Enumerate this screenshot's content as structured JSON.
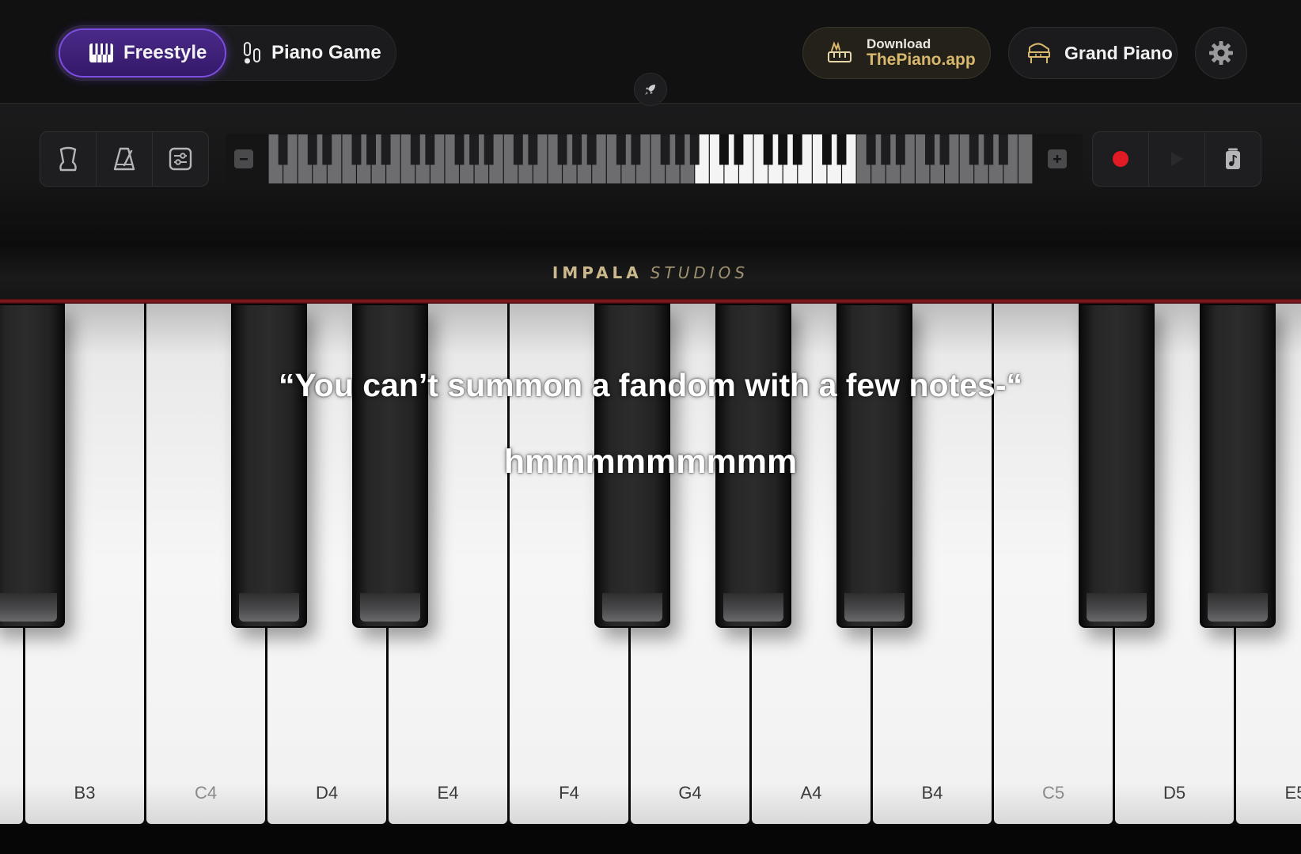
{
  "header": {
    "modes": [
      {
        "label": "Freestyle",
        "icon": "piano-keys-icon",
        "active": true
      },
      {
        "label": "Piano Game",
        "icon": "piano-game-icon",
        "active": false
      }
    ],
    "download": {
      "line1": "Download",
      "line2": "ThePiano.app",
      "icon": "piano-hand-icon"
    },
    "instrument": {
      "label": "Grand Piano",
      "icon": "grand-piano-icon"
    },
    "settings_icon": "gear-icon",
    "rocket_icon": "rocket-icon"
  },
  "controls": {
    "left_tools": [
      "sustain-pedal-icon",
      "metronome-icon",
      "equalizer-icon"
    ],
    "zoom_out_icon": "minus-icon",
    "zoom_in_icon": "plus-icon",
    "right_tools": [
      "record-icon",
      "play-icon",
      "song-file-icon"
    ],
    "minimap": {
      "total_white_keys": 52,
      "visible_start": 29,
      "visible_end": 39
    }
  },
  "brand": {
    "part1": "IMPALA",
    "part2": "STUDIOS"
  },
  "keyboard": {
    "white_keys": [
      {
        "note": "",
        "muted": false
      },
      {
        "note": "B3",
        "muted": false
      },
      {
        "note": "C4",
        "muted": true
      },
      {
        "note": "D4",
        "muted": false
      },
      {
        "note": "E4",
        "muted": false
      },
      {
        "note": "F4",
        "muted": false
      },
      {
        "note": "G4",
        "muted": false
      },
      {
        "note": "A4",
        "muted": false
      },
      {
        "note": "B4",
        "muted": false
      },
      {
        "note": "C5",
        "muted": true
      },
      {
        "note": "D5",
        "muted": false
      },
      {
        "note": "E5",
        "muted": false
      }
    ]
  },
  "captions": {
    "line1": "“You can’t summon a fandom with a few notes-“",
    "line2": "hmmmmmmmmm"
  },
  "colors": {
    "accent_purple": "#7b4de0",
    "gold": "#d8b86c",
    "record_red": "#e01b24"
  }
}
